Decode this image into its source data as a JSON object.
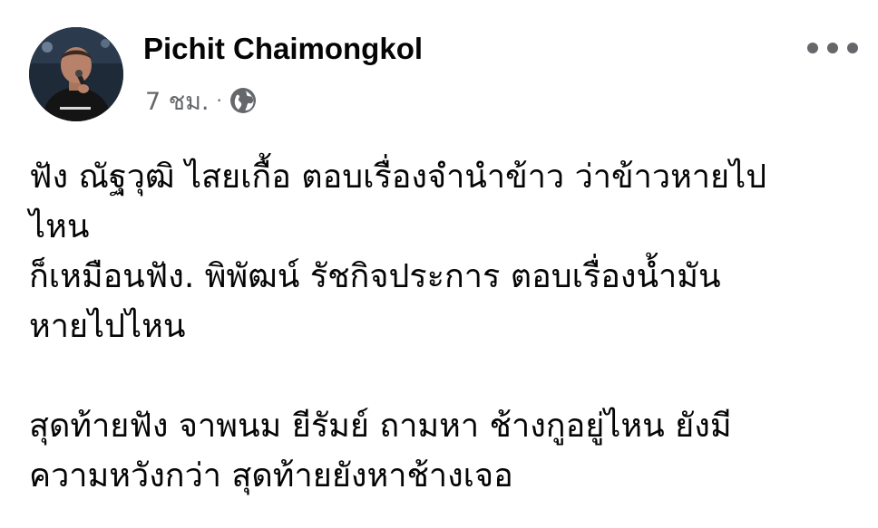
{
  "post": {
    "author": "Pichit Chaimongkol",
    "timestamp": "7 ชม.",
    "separator": "·",
    "audience_icon": "globe-icon",
    "more_icon": "more-options-icon",
    "body_lines": [
      "ฟัง ณัฐวุฒิ ไสยเกื้อ ตอบเรื่องจำนำข้าว ว่าข้าวหายไป",
      "ไหน",
      "ก็เหมือนฟัง. พิพัฒน์ รัชกิจประการ ตอบเรื่องน้ำมัน",
      "หายไปไหน",
      "",
      " สุดท้ายฟัง จาพนม ยีรัมย์ ถามหา ช้างกูอยู่ไหน ยังมี",
      "ความหวังกว่า สุดท้ายยังหาช้างเจอ"
    ]
  },
  "colors": {
    "text": "#050505",
    "secondary": "#65676b",
    "avatar_bg": "#1a2230"
  }
}
